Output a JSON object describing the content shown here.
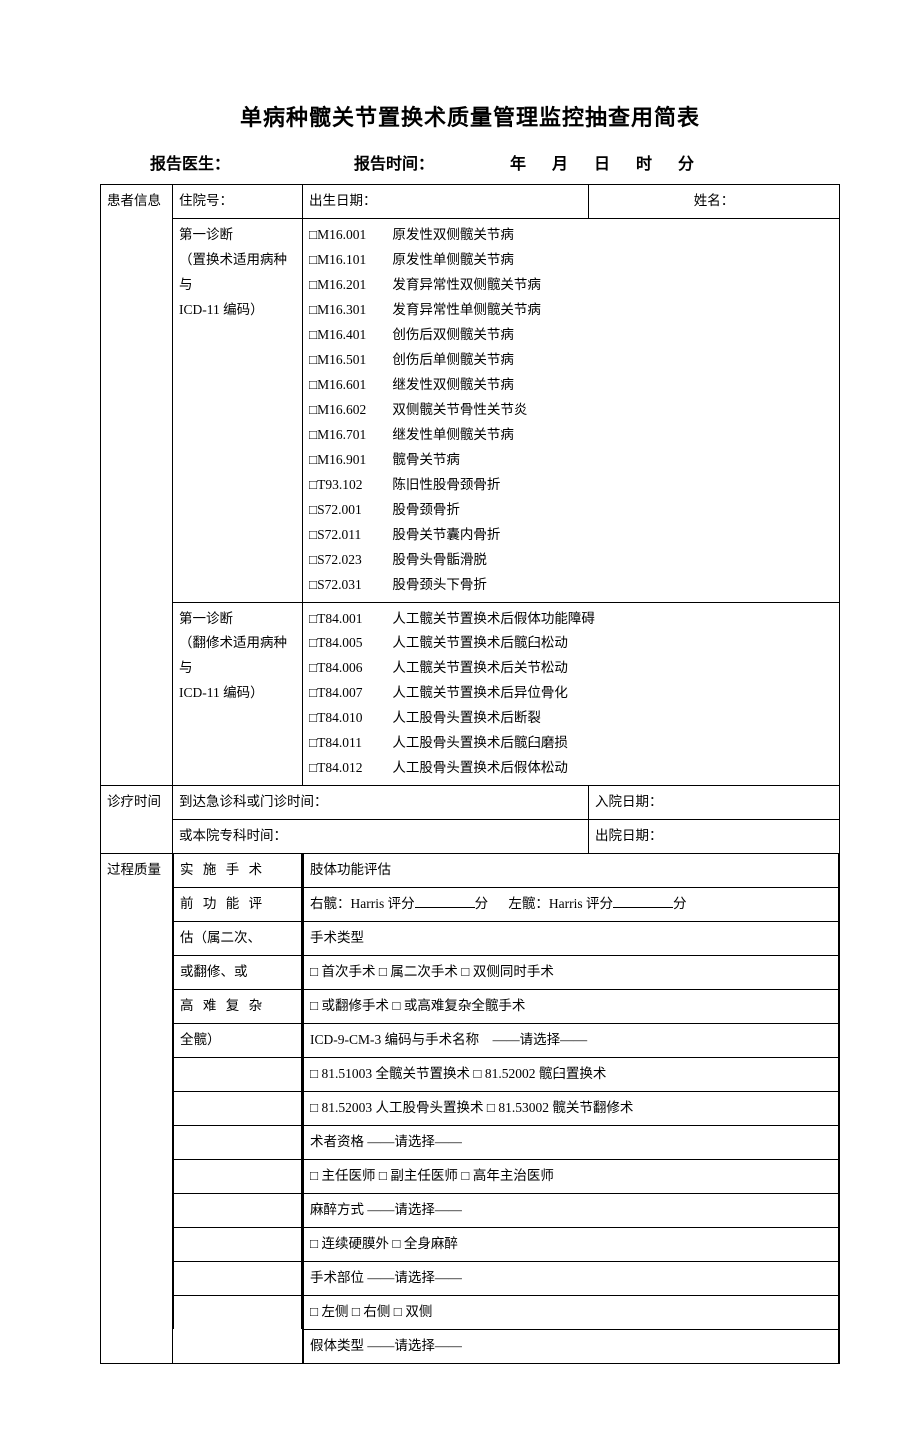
{
  "title": "单病种髋关节置换术质量管理监控抽查用简表",
  "report_line": {
    "doctor_label": "报告医生：",
    "time_label": "报告时间：",
    "year": "年",
    "month": "月",
    "day": "日",
    "hour": "时",
    "minute": "分"
  },
  "sections": {
    "patient": "患者信息",
    "visit_time": "诊疗时间",
    "process_quality": "过程质量"
  },
  "patient_row": {
    "hosp_no": "住院号：",
    "dob": "出生日期：",
    "name": "姓名："
  },
  "diag1_label": {
    "a": "第一诊断",
    "b": "（置换术适用病种与",
    "c": "ICD-11 编码）"
  },
  "diag1_items": [
    {
      "code": "□M16.001",
      "text": "原发性双侧髋关节病"
    },
    {
      "code": "□M16.101",
      "text": "原发性单侧髋关节病"
    },
    {
      "code": "□M16.201",
      "text": "发育异常性双侧髋关节病"
    },
    {
      "code": "□M16.301",
      "text": "发育异常性单侧髋关节病"
    },
    {
      "code": "□M16.401",
      "text": "创伤后双侧髋关节病"
    },
    {
      "code": "□M16.501",
      "text": "创伤后单侧髋关节病"
    },
    {
      "code": "□M16.601",
      "text": "继发性双侧髋关节病"
    },
    {
      "code": "□M16.602",
      "text": "双侧髋关节骨性关节炎"
    },
    {
      "code": "□M16.701",
      "text": "继发性单侧髋关节病"
    },
    {
      "code": "□M16.901",
      "text": "髋骨关节病"
    },
    {
      "code": "□T93.102",
      "text": "陈旧性股骨颈骨折"
    },
    {
      "code": "□S72.001",
      "text": "股骨颈骨折"
    },
    {
      "code": "□S72.011",
      "text": "股骨关节囊内骨折"
    },
    {
      "code": "□S72.023",
      "text": "股骨头骨骺滑脱"
    },
    {
      "code": "□S72.031",
      "text": "股骨颈头下骨折"
    }
  ],
  "diag2_label": {
    "a": "第一诊断",
    "b": "（翻修术适用病种与",
    "c": "ICD-11 编码）"
  },
  "diag2_items": [
    {
      "code": "□T84.001",
      "text": "人工髋关节置换术后假体功能障碍"
    },
    {
      "code": "□T84.005",
      "text": "人工髋关节置换术后髋臼松动"
    },
    {
      "code": "□T84.006",
      "text": "人工髋关节置换术后关节松动"
    },
    {
      "code": "□T84.007",
      "text": "人工髋关节置换术后异位骨化"
    },
    {
      "code": "□T84.010",
      "text": "人工股骨头置换术后断裂"
    },
    {
      "code": "□T84.011",
      "text": "人工股骨头置换术后髋臼磨损"
    },
    {
      "code": "□T84.012",
      "text": "人工股骨头置换术后假体松动"
    }
  ],
  "visit": {
    "arrival": "到达急诊科或门诊时间：",
    "admit": "入院日期：",
    "dept": "或本院专科时间：",
    "discharge": "出院日期："
  },
  "preop_label": {
    "a": "实 施 手 术",
    "b": "前 功 能 评",
    "c": "估（属二次、",
    "d": "或翻修、或",
    "e": "高 难 复 杂",
    "f": "全髋）"
  },
  "preop": {
    "limb_eval": "肢体功能评估",
    "harris_right_l": "右髋：Harris 评分",
    "harris_left_l": "左髋：Harris 评分",
    "score_unit": "分",
    "surg_type": "手术类型",
    "type_line1": "□  首次手术   □  属二次手术  □  双侧同时手术",
    "type_line2": "□   或翻修手术    □  或高难复杂全髋手术",
    "icd9": "ICD-9-CM-3 编码与手术名称　——请选择——",
    "icd9_opt1": "□  81.51003   全髋关节置换术   □  81.52002   髋臼置换术",
    "icd9_opt2": "□   81.52003   人工股骨头置换术   □  81.53002  髋关节翻修术",
    "surgeon_q": "术者资格  ——请选择——",
    "surgeon_opts": "□ 主任医师  □ 副主任医师  □ 高年主治医师",
    "anes": "麻醉方式  ——请选择——",
    "anes_opts": "□ 连续硬膜外   □ 全身麻醉",
    "site": "手术部位  ——请选择——",
    "site_opts": "□  左侧     □  右侧      □  双侧",
    "prosth": "假体类型  ——请选择——"
  }
}
